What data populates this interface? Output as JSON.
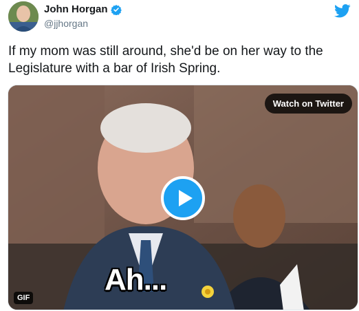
{
  "author": {
    "display_name": "John Horgan",
    "handle": "@jjhorgan",
    "verified_icon": "verified-badge-icon",
    "avatar": "profile-photo"
  },
  "brand": {
    "icon": "twitter-bird-icon",
    "color": "#1da1f2"
  },
  "tweet": {
    "text_line_1": "If my mom was still around, she'd be on her way to the",
    "text_line_2": "Legislature with a bar of Irish Spring."
  },
  "media": {
    "watch_label": "Watch on Twitter",
    "play_icon": "play-icon",
    "caption": "Ah...",
    "badge": "GIF"
  },
  "colors": {
    "text": "#14171a",
    "secondary": "#657786",
    "accent": "#1da1f2"
  }
}
